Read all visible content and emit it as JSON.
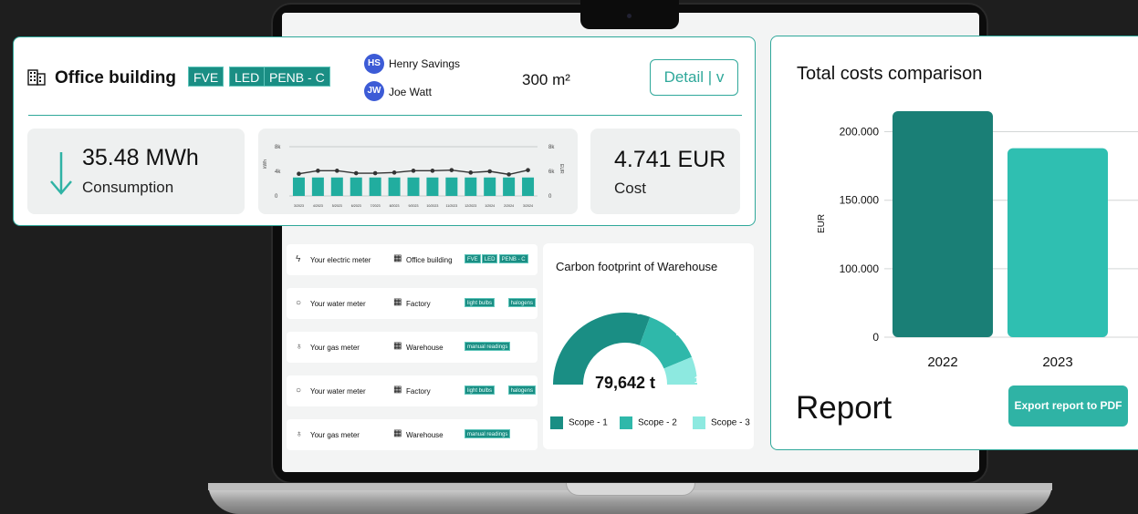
{
  "building": {
    "title": "Office building",
    "tags": [
      "FVE",
      "LED",
      "PENB - C"
    ],
    "people": [
      {
        "initials": "HS",
        "name": "Henry Savings"
      },
      {
        "initials": "JW",
        "name": "Joe Watt"
      }
    ],
    "area": "300 m²",
    "detail_label": "Detail | v"
  },
  "consumption": {
    "value": "35.48 MWh",
    "label": "Consumption"
  },
  "cost": {
    "value": "4.741 EUR",
    "label": "Cost"
  },
  "mini_chart": {
    "type": "bar",
    "left_axis_label": "kWh",
    "right_axis_label": "EUR",
    "left_ticks": [
      "8k",
      "4k",
      "0"
    ],
    "right_ticks": [
      "8k",
      "6k",
      "0"
    ],
    "ylim": [
      0,
      8000
    ],
    "categories": [
      "3/2023",
      "4/2023",
      "5/2023",
      "6/2023",
      "7/2023",
      "8/2023",
      "9/2023",
      "10/2023",
      "11/2023",
      "12/2023",
      "1/2024",
      "2/2024",
      "3/2024"
    ],
    "bar_values": [
      3000,
      3000,
      3000,
      3000,
      3000,
      3000,
      3000,
      3000,
      3000,
      3000,
      3000,
      3000,
      3000
    ],
    "line_values": [
      3600,
      4100,
      4100,
      3700,
      3700,
      3800,
      4100,
      4100,
      4200,
      3800,
      4000,
      3500,
      4200
    ]
  },
  "meters": [
    {
      "icon": "lightning-icon",
      "glyph": "ϟ",
      "name": "Your electric meter",
      "building": "Office building",
      "tags": [
        "FVE",
        "LED",
        "PENB - C"
      ]
    },
    {
      "icon": "water-drop-icon",
      "glyph": "○",
      "name": "Your water meter",
      "building": "Factory",
      "tags": [
        "light bulbs",
        "halogens"
      ]
    },
    {
      "icon": "gas-flame-icon",
      "glyph": "♁",
      "name": "Your gas meter",
      "building": "Warehouse",
      "tags": [
        "manual readings"
      ]
    },
    {
      "icon": "water-drop-icon",
      "glyph": "○",
      "name": "Your water meter",
      "building": "Factory",
      "tags": [
        "light bulbs",
        "halogens"
      ]
    },
    {
      "icon": "gas-flame-icon",
      "glyph": "♁",
      "name": "Your gas meter",
      "building": "Warehouse",
      "tags": [
        "manual readings"
      ]
    }
  ],
  "carbon": {
    "title": "Carbon footprint of Warehouse",
    "total": "79,642 t",
    "slices": [
      {
        "name": "Scope - 1",
        "percent": 61.2,
        "label": "61.2%",
        "color": "#1a8e84"
      },
      {
        "name": "Scope - 2",
        "percent": 26.3,
        "label": "26.3%",
        "color": "#2fb8aa"
      },
      {
        "name": "Scope - 3",
        "percent": 12.5,
        "label": "12.5%",
        "color": "#8de9e0"
      }
    ]
  },
  "chart_data": {
    "type": "bar",
    "title": "Total costs comparison",
    "ylabel": "EUR",
    "categories": [
      "2022",
      "2023"
    ],
    "values": [
      215000,
      188000
    ],
    "ytick_labels": [
      "200.000",
      "150.000",
      "100.000",
      "0"
    ],
    "ytick_values": [
      200000,
      150000,
      100000,
      50000
    ],
    "ylim": [
      50000,
      215000
    ],
    "grid": true
  },
  "report": {
    "title": "Report",
    "export_label": "Export report to PDF"
  },
  "colors": {
    "accent": "#2fa89a",
    "bar_dark": "#1a7f76",
    "bar_light": "#2fbfb1"
  }
}
